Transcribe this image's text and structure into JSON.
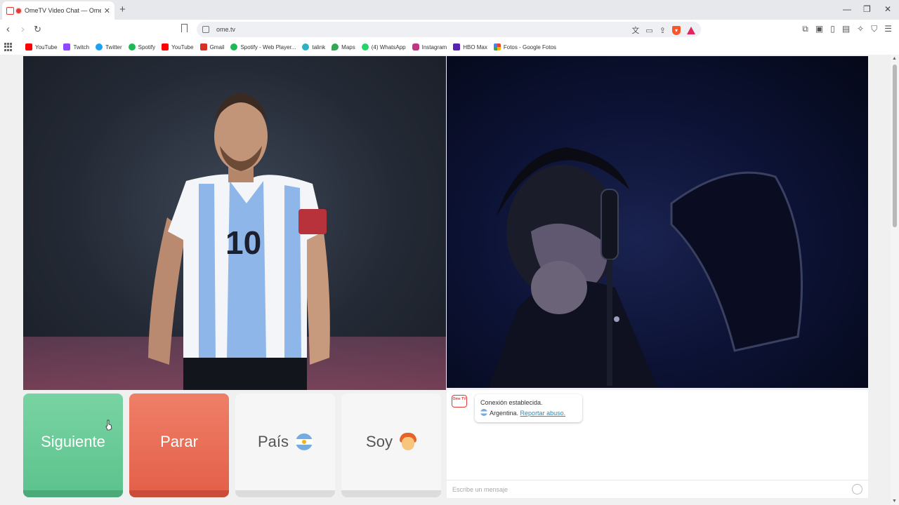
{
  "browser": {
    "tab_title": "OmeTV Video Chat — Omeg",
    "tab_close": "✕",
    "new_tab": "+",
    "url": "ome.tv",
    "window_controls": {
      "minimize": "—",
      "restore": "❐",
      "close": "✕"
    }
  },
  "bookmarks": [
    {
      "label": "YouTube",
      "icon": "youtube-icon",
      "color": "#ff0000"
    },
    {
      "label": "Twitch",
      "icon": "twitch-icon",
      "color": "#9146ff"
    },
    {
      "label": "Twitter",
      "icon": "twitter-icon",
      "color": "#1da1f2"
    },
    {
      "label": "Spotify",
      "icon": "spotify-icon",
      "color": "#1db954"
    },
    {
      "label": "YouTube",
      "icon": "youtube-icon",
      "color": "#ff0000"
    },
    {
      "label": "Gmail",
      "icon": "gmail-icon",
      "color": "#d93025"
    },
    {
      "label": "Spotify - Web Player...",
      "icon": "spotify-icon",
      "color": "#1db954"
    },
    {
      "label": "talink",
      "icon": "talink-icon",
      "color": "#2bb3c0"
    },
    {
      "label": "Maps",
      "icon": "maps-icon",
      "color": "#34a853"
    },
    {
      "label": "(4) WhatsApp",
      "icon": "whatsapp-icon",
      "color": "#25d366"
    },
    {
      "label": "Instagram",
      "icon": "instagram-icon",
      "color": "#c13584"
    },
    {
      "label": "HBO Max",
      "icon": "hbo-max-icon",
      "color": "#5822b4"
    },
    {
      "label": "Fotos - Google Fotos",
      "icon": "google-photos-icon",
      "color": "#fbbc04"
    }
  ],
  "controls": {
    "next_label": "Siguiente",
    "stop_label": "Parar",
    "country_label": "País",
    "soy_label": "Soy"
  },
  "chat": {
    "logo_text": "Ome TV",
    "status_line": "Conexión establecida.",
    "country": "Argentina.",
    "report_link": "Reportar abuso.",
    "input_placeholder": "Escribe un mensaje"
  },
  "colors": {
    "next": "#5dc48e",
    "stop": "#e4614a",
    "link": "#1a8fc9"
  }
}
